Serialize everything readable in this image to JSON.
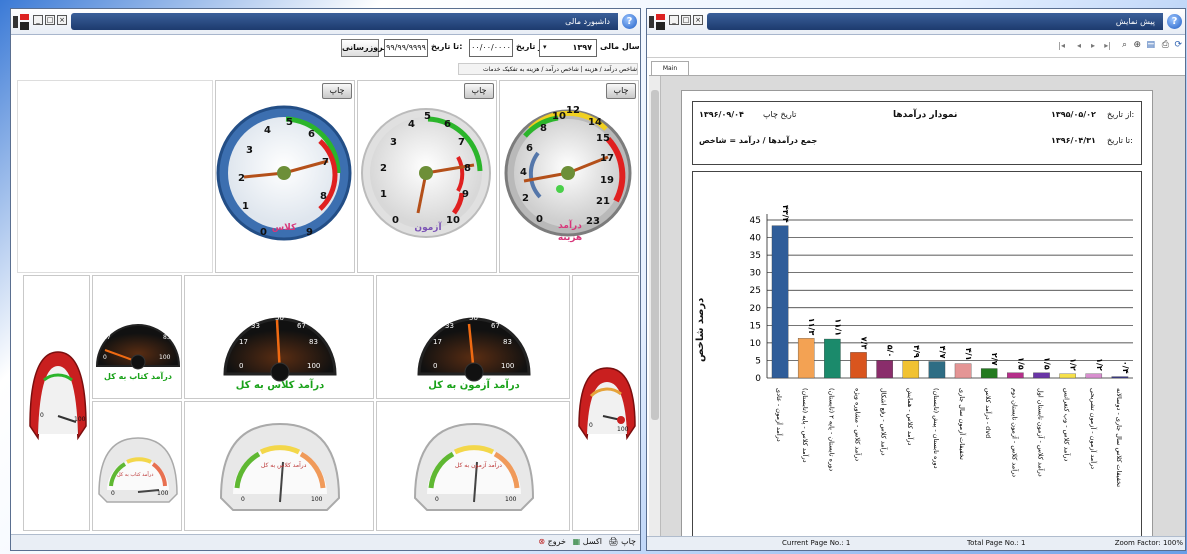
{
  "left_window": {
    "title": "داشبورد مالی",
    "filters": {
      "fiscal_year_label": "سال مالی",
      "fiscal_year_value": "۱۳۹۷",
      "from_date_label": "از تاریخ:",
      "from_date_value": "۰۰/۰۰/۰۰۰۰",
      "to_date_label": "تا تاریخ:",
      "to_date_value": "۹۹/۹۹/۹۹۹۹",
      "update_button": "بروزرسانی"
    },
    "breadcrumb": "شاخص درآمد / هزینه  |  شاخص درآمد / هزینه به تفکیک خدمات",
    "print_label": "چاپ",
    "gauges_top": [
      {
        "label_line1": "درآمد",
        "label_line2": "هزینه",
        "ticks": [
          "0",
          "2",
          "4",
          "6",
          "8",
          "10",
          "12",
          "14",
          "15",
          "17",
          "19",
          "21",
          "23"
        ]
      },
      {
        "label_line1": "آزمون",
        "ticks": [
          "0",
          "1",
          "2",
          "3",
          "4",
          "5",
          "6",
          "7",
          "8",
          "9",
          "10"
        ]
      },
      {
        "label_line1": "کلاس",
        "ticks": [
          "0",
          "1",
          "2",
          "3",
          "4",
          "5",
          "6",
          "7",
          "8",
          "9"
        ]
      }
    ],
    "gauges_dark": [
      {
        "label": "درآمد آزمون به کل",
        "ticks": [
          "0",
          "17",
          "33",
          "50",
          "67",
          "83",
          "100"
        ]
      },
      {
        "label": "درآمد کلاس به کل",
        "ticks": [
          "0",
          "17",
          "33",
          "50",
          "67",
          "83",
          "100"
        ]
      },
      {
        "label": "درآمد کتاب به کل",
        "ticks": [
          "0",
          "17",
          "33",
          "50",
          "67",
          "83",
          "100"
        ]
      }
    ],
    "gauges_light": [
      {
        "label": "درآمد آزمون به کل",
        "ticks": [
          "0",
          "100"
        ]
      },
      {
        "label": "درآمد کلاس به کل",
        "ticks": [
          "0",
          "100"
        ]
      },
      {
        "label": "درآمد کتاب به کل",
        "ticks": [
          "0",
          "100"
        ]
      }
    ],
    "side_gauge_ticks": [
      "0",
      "100"
    ],
    "status": {
      "print": "چاپ",
      "excel": "اکسل",
      "exit": "خروج"
    }
  },
  "right_window": {
    "title": "پیش نمایش",
    "tab": "Main Report",
    "report": {
      "print_date_label": "تاریخ چاپ",
      "print_date_value": "۱۳۹۶/۰۹/۰۴",
      "title": "نمودار درآمدها",
      "from_label": "از تاریخ:",
      "from_value": "۱۳۹۵/۰۵/۰۲",
      "to_label": "تا تاریخ:",
      "to_value": "۱۳۹۶/۰۴/۳۱",
      "subtitle": "جمع درآمدها / درآمد = شاخص"
    },
    "status": {
      "current_page": "Current Page No.: 1",
      "total_page": "Total Page No.: 1",
      "zoom": "Zoom Factor: 100%"
    }
  },
  "chart_data": {
    "type": "bar",
    "ylabel": "درصد شاخص",
    "ylim": [
      0,
      45
    ],
    "yticks": [
      "0",
      "5",
      "10",
      "15",
      "20",
      "25",
      "30",
      "35",
      "40",
      "45"
    ],
    "categories": [
      "درآمد آزمون - عادی",
      "درآمد کلاس - پایه (تابستان)",
      "دوره تابستان - پایه ۲ (تابستان)",
      "درآمد کلاس - مشاوره ویژه",
      "درآمد کلاس - رفع اشکال",
      "درآمد کلاس - همایش",
      "دوره تابستان - پیش (تابستان)",
      "تخفیفات آزمون سال جاری",
      "درآمد کلاس - dvd",
      "درآمد کلاس - آزمون تابستان دوم",
      "درآمد کلاس - آزمون تابستان اول",
      "درآمد کلاس - وب کنفرانس",
      "درآمد آزمون - آزمون تشریحی",
      "تخفیفات کلاس سال جاری - دوسالانه"
    ],
    "values": [
      43.4,
      11.3,
      11.1,
      7.3,
      5.0,
      4.9,
      4.7,
      4.1,
      2.7,
      1.5,
      1.5,
      1.2,
      1.2,
      0.4
    ],
    "value_labels": [
      "۴۳/۴",
      "۱۱/۳",
      "۱۱/۱",
      "۷/۳",
      "۵/۰",
      "۴/۹",
      "۴/۷",
      "۴/۱",
      "۲/۷",
      "۱/۵",
      "۱/۵",
      "۱/۲",
      "۱/۲",
      "۰/۴"
    ],
    "colors": [
      "#2f5d99",
      "#f3a253",
      "#1b8a6b",
      "#d9551e",
      "#8a2d6b",
      "#f1c232",
      "#2e6d84",
      "#e49595",
      "#237a1f",
      "#b52f8a",
      "#6a35a6",
      "#f6e04a",
      "#d88fcf",
      "#3a3a8a"
    ],
    "grid": true
  }
}
